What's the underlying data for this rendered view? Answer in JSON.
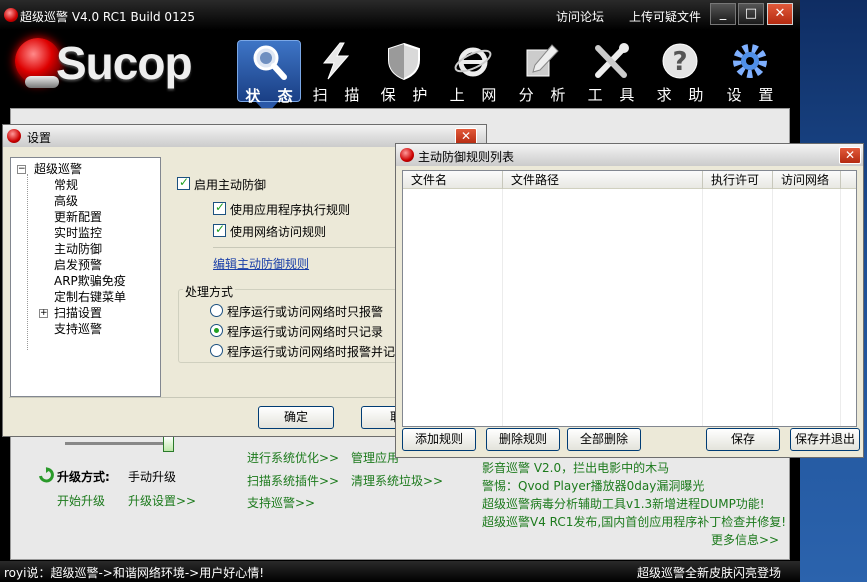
{
  "app": {
    "title": "超级巡警 V4.0 RC1 Build 0125",
    "links": [
      "访问论坛",
      "上传可疑文件"
    ],
    "window_buttons": [
      "_",
      "□",
      "✕"
    ],
    "brand": "Sucop",
    "nav": [
      {
        "label": "状 态",
        "icon": "magnifier-icon"
      },
      {
        "label": "扫 描",
        "icon": "lightning-icon"
      },
      {
        "label": "保 护",
        "icon": "shield-icon"
      },
      {
        "label": "上 网",
        "icon": "ie-browser-icon"
      },
      {
        "label": "分 析",
        "icon": "pencil-icon"
      },
      {
        "label": "工 具",
        "icon": "tools-icon"
      },
      {
        "label": "求 助",
        "icon": "help-icon"
      },
      {
        "label": "设 置",
        "icon": "gear-icon"
      }
    ],
    "active_nav": 0,
    "upgrade_label": "升级方式:",
    "upgrade_value": "手动升级",
    "start_upgrade": "开始升级",
    "upgrade_settings": "升级设置>>",
    "links_col1": [
      "进行系统优化>>",
      "扫描系统插件>>",
      "支持巡警>>"
    ],
    "links_col2": [
      "管理应用",
      "清理系统垃圾>>"
    ],
    "news": [
      "影音巡警 V2.0，拦出电影中的木马",
      "警惕：Qvod Player播放器0day漏洞曝光",
      "超级巡警病毒分析辅助工具v1.3新增进程DUMP功能!",
      "超级巡警V4 RC1发布,国内首创应用程序补丁检查并修复!"
    ],
    "more_info": "更多信息>>",
    "status_left": "royi说：超级巡警->和谐网络环境->用户好心情!",
    "status_right": "超级巡警全新皮肤闪亮登场",
    "colors": {
      "accent": "#2a58a8",
      "link_green": "#1c7a1c",
      "close_red": "#c8391b"
    }
  },
  "settings": {
    "title": "设置",
    "tree": {
      "root": "超级巡警",
      "items": [
        "常规",
        "高级",
        "更新配置",
        "实时监控",
        "主动防御",
        "启发预警",
        "ARP欺骗免疫",
        "定制右键菜单",
        "扫描设置",
        "支持巡警"
      ]
    },
    "enable_active_defense": {
      "label": "启用主动防御",
      "checked": true
    },
    "use_app_rules": {
      "label": "使用应用程序执行规则",
      "checked": true
    },
    "use_net_rules": {
      "label": "使用网络访问规则",
      "checked": true
    },
    "edit_rules_link": "编辑主动防御规则",
    "group_title": "处理方式",
    "radios": [
      {
        "label": "程序运行或访问网络时只报警",
        "checked": false
      },
      {
        "label": "程序运行或访问网络时只记录",
        "checked": true
      },
      {
        "label": "程序运行或访问网络时报警并记录",
        "checked": false
      }
    ],
    "ok_button": "确定",
    "cancel_button_partial": "取"
  },
  "rules": {
    "title": "主动防御规则列表",
    "columns": [
      "文件名",
      "文件路径",
      "执行许可",
      "访问网络"
    ],
    "rows": [],
    "buttons": {
      "add": "添加规则",
      "delete": "删除规则",
      "delete_all": "全部删除",
      "save": "保存",
      "save_exit": "保存并退出"
    }
  }
}
